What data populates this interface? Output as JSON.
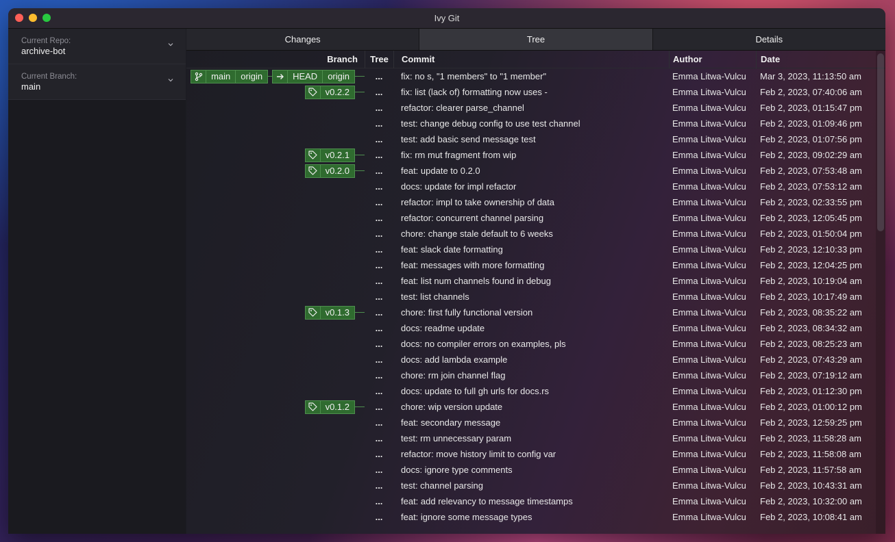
{
  "window": {
    "title": "Ivy Git"
  },
  "sidebar": {
    "repo": {
      "label": "Current Repo:",
      "value": "archive-bot"
    },
    "branch": {
      "label": "Current Branch:",
      "value": "main"
    }
  },
  "tabs": [
    {
      "label": "Changes",
      "active": false
    },
    {
      "label": "Tree",
      "active": true
    },
    {
      "label": "Details",
      "active": false
    }
  ],
  "columns": {
    "branch": "Branch",
    "tree": "Tree",
    "commit": "Commit",
    "author": "Author",
    "date": "Date"
  },
  "commits": [
    {
      "refs": "head",
      "tree": "...",
      "message": "fix: no s, \"1 members\" to \"1 member\"",
      "author": "Emma Litwa-Vulcu",
      "date": "Mar 3, 2023, 11:13:50 am"
    },
    {
      "tag": "v0.2.2",
      "tree": "...",
      "message": "fix: list (lack of) formatting now uses -",
      "author": "Emma Litwa-Vulcu",
      "date": "Feb 2, 2023, 07:40:06 am"
    },
    {
      "tree": "...",
      "message": "refactor: clearer parse_channel",
      "author": "Emma Litwa-Vulcu",
      "date": "Feb 2, 2023, 01:15:47 pm"
    },
    {
      "tree": "...",
      "message": "test: change debug config to use test channel",
      "author": "Emma Litwa-Vulcu",
      "date": "Feb 2, 2023, 01:09:46 pm"
    },
    {
      "tree": "...",
      "message": "test: add basic send message test",
      "author": "Emma Litwa-Vulcu",
      "date": "Feb 2, 2023, 01:07:56 pm"
    },
    {
      "tag": "v0.2.1",
      "tree": "...",
      "message": "fix: rm mut fragment from wip",
      "author": "Emma Litwa-Vulcu",
      "date": "Feb 2, 2023, 09:02:29 am"
    },
    {
      "tag": "v0.2.0",
      "tree": "...",
      "message": "feat: update to 0.2.0",
      "author": "Emma Litwa-Vulcu",
      "date": "Feb 2, 2023, 07:53:48 am"
    },
    {
      "tree": "...",
      "message": "docs: update for impl refactor",
      "author": "Emma Litwa-Vulcu",
      "date": "Feb 2, 2023, 07:53:12 am"
    },
    {
      "tree": "...",
      "message": "refactor: impl to take ownership of data",
      "author": "Emma Litwa-Vulcu",
      "date": "Feb 2, 2023, 02:33:55 pm"
    },
    {
      "tree": "...",
      "message": "refactor: concurrent channel parsing",
      "author": "Emma Litwa-Vulcu",
      "date": "Feb 2, 2023, 12:05:45 pm"
    },
    {
      "tree": "...",
      "message": "chore: change stale default to 6 weeks",
      "author": "Emma Litwa-Vulcu",
      "date": "Feb 2, 2023, 01:50:04 pm"
    },
    {
      "tree": "...",
      "message": "feat: slack date formatting",
      "author": "Emma Litwa-Vulcu",
      "date": "Feb 2, 2023, 12:10:33 pm"
    },
    {
      "tree": "...",
      "message": "feat: messages with more formatting",
      "author": "Emma Litwa-Vulcu",
      "date": "Feb 2, 2023, 12:04:25 pm"
    },
    {
      "tree": "...",
      "message": "feat: list num channels found in debug",
      "author": "Emma Litwa-Vulcu",
      "date": "Feb 2, 2023, 10:19:04 am"
    },
    {
      "tree": "...",
      "message": "test: list channels",
      "author": "Emma Litwa-Vulcu",
      "date": "Feb 2, 2023, 10:17:49 am"
    },
    {
      "tag": "v0.1.3",
      "tree": "...",
      "message": "chore: first fully functional version",
      "author": "Emma Litwa-Vulcu",
      "date": "Feb 2, 2023, 08:35:22 am"
    },
    {
      "tree": "...",
      "message": "docs: readme update",
      "author": "Emma Litwa-Vulcu",
      "date": "Feb 2, 2023, 08:34:32 am"
    },
    {
      "tree": "...",
      "message": "docs: no compiler errors on examples, pls",
      "author": "Emma Litwa-Vulcu",
      "date": "Feb 2, 2023, 08:25:23 am"
    },
    {
      "tree": "...",
      "message": "docs: add lambda example",
      "author": "Emma Litwa-Vulcu",
      "date": "Feb 2, 2023, 07:43:29 am"
    },
    {
      "tree": "...",
      "message": "chore: rm join channel flag",
      "author": "Emma Litwa-Vulcu",
      "date": "Feb 2, 2023, 07:19:12 am"
    },
    {
      "tree": "...",
      "message": "docs: update to full gh urls for docs.rs",
      "author": "Emma Litwa-Vulcu",
      "date": "Feb 2, 2023, 01:12:30 pm"
    },
    {
      "tag": "v0.1.2",
      "tree": "...",
      "message": "chore: wip version update",
      "author": "Emma Litwa-Vulcu",
      "date": "Feb 2, 2023, 01:00:12 pm"
    },
    {
      "tree": "...",
      "message": "feat: secondary message",
      "author": "Emma Litwa-Vulcu",
      "date": "Feb 2, 2023, 12:59:25 pm"
    },
    {
      "tree": "...",
      "message": "test: rm unnecessary param",
      "author": "Emma Litwa-Vulcu",
      "date": "Feb 2, 2023, 11:58:28 am"
    },
    {
      "tree": "...",
      "message": "refactor: move history limit to config var",
      "author": "Emma Litwa-Vulcu",
      "date": "Feb 2, 2023, 11:58:08 am"
    },
    {
      "tree": "...",
      "message": "docs: ignore type comments",
      "author": "Emma Litwa-Vulcu",
      "date": "Feb 2, 2023, 11:57:58 am"
    },
    {
      "tree": "...",
      "message": "test: channel parsing",
      "author": "Emma Litwa-Vulcu",
      "date": "Feb 2, 2023, 10:43:31 am"
    },
    {
      "tree": "...",
      "message": "feat: add relevancy to message timestamps",
      "author": "Emma Litwa-Vulcu",
      "date": "Feb 2, 2023, 10:32:00 am"
    },
    {
      "tree": "...",
      "message": "feat: ignore some message types",
      "author": "Emma Litwa-Vulcu",
      "date": "Feb 2, 2023, 10:08:41 am"
    }
  ],
  "head_refs": {
    "branch": "main",
    "remote": "origin",
    "head": "HEAD",
    "head_remote": "origin"
  },
  "icons": {
    "branch": "git-branch-icon",
    "tag": "tag-icon",
    "arrow": "arrow-right-icon",
    "chevron": "chevron-down-icon"
  },
  "colors": {
    "chip_bg": "#2f6b2f",
    "chip_border": "#4e8f4e",
    "traffic_close": "#ff5f57",
    "traffic_min": "#febc2e",
    "traffic_max": "#28c840"
  }
}
